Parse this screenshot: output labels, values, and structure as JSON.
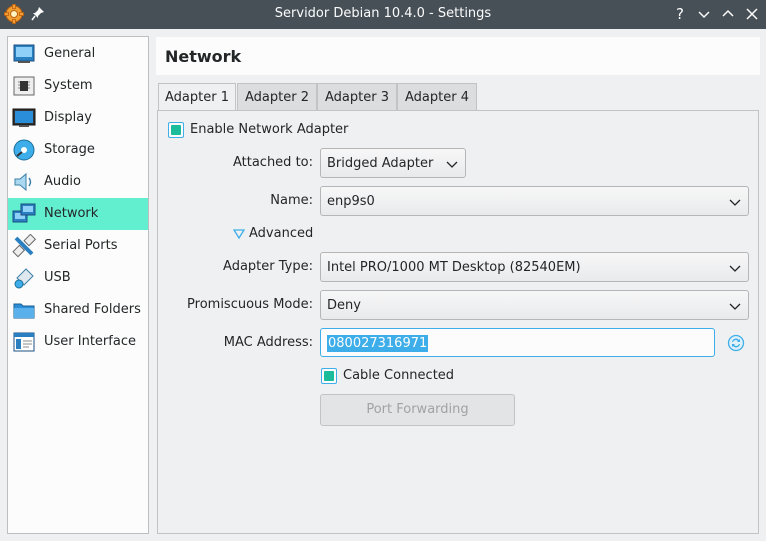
{
  "window": {
    "title": "Servidor Debian 10.4.0 - Settings"
  },
  "sidebar": {
    "items": [
      {
        "label": "General",
        "icon": "general-icon"
      },
      {
        "label": "System",
        "icon": "system-icon"
      },
      {
        "label": "Display",
        "icon": "display-icon"
      },
      {
        "label": "Storage",
        "icon": "storage-icon"
      },
      {
        "label": "Audio",
        "icon": "audio-icon"
      },
      {
        "label": "Network",
        "icon": "network-icon",
        "active": true
      },
      {
        "label": "Serial Ports",
        "icon": "serial-ports-icon"
      },
      {
        "label": "USB",
        "icon": "usb-icon"
      },
      {
        "label": "Shared Folders",
        "icon": "shared-folders-icon"
      },
      {
        "label": "User Interface",
        "icon": "user-interface-icon"
      }
    ]
  },
  "header": {
    "title": "Network"
  },
  "tabs": [
    {
      "label": "Adapter 1",
      "active": true
    },
    {
      "label": "Adapter 2"
    },
    {
      "label": "Adapter 3"
    },
    {
      "label": "Adapter 4"
    }
  ],
  "adapter": {
    "enable_label": "Enable Network Adapter",
    "enable_checked": true,
    "attached_to_label": "Attached to:",
    "attached_to_value": "Bridged Adapter",
    "name_label": "Name:",
    "name_value": "enp9s0",
    "advanced_label": "Advanced",
    "adapter_type_label": "Adapter Type:",
    "adapter_type_value": "Intel PRO/1000 MT Desktop (82540EM)",
    "promiscuous_label": "Promiscuous Mode:",
    "promiscuous_value": "Deny",
    "mac_label": "MAC Address:",
    "mac_value": "080027316971",
    "cable_label": "Cable Connected",
    "cable_checked": true,
    "port_forwarding_label": "Port Forwarding"
  },
  "colors": {
    "titlebar": "#475057",
    "active_item": "#62efd0",
    "accent": "#3daee9",
    "check": "#1abc9c"
  }
}
